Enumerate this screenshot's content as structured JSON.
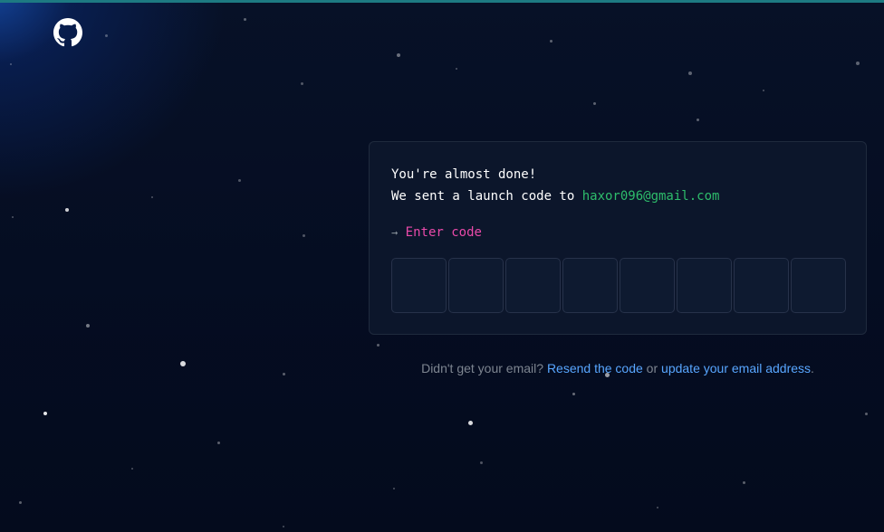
{
  "colors": {
    "background": "#040d21",
    "card_background": "#0c162b",
    "email_color": "#2ebd6b",
    "prompt_color": "#ea4aaa",
    "link_color": "#58a6ff",
    "muted_text": "#7d8590"
  },
  "header": {
    "logo_icon": "github-octocat-icon"
  },
  "card": {
    "line1": "You're almost done!",
    "line2_prefix": "We sent a launch code to ",
    "email": "haxor096@gmail.com",
    "prompt_arrow": "→",
    "prompt_label": "Enter code",
    "code_length": 8
  },
  "footer": {
    "prefix": "Didn't get your email? ",
    "resend_link": "Resend the code",
    "middle": " or ",
    "update_link": "update your email address",
    "suffix": "."
  }
}
